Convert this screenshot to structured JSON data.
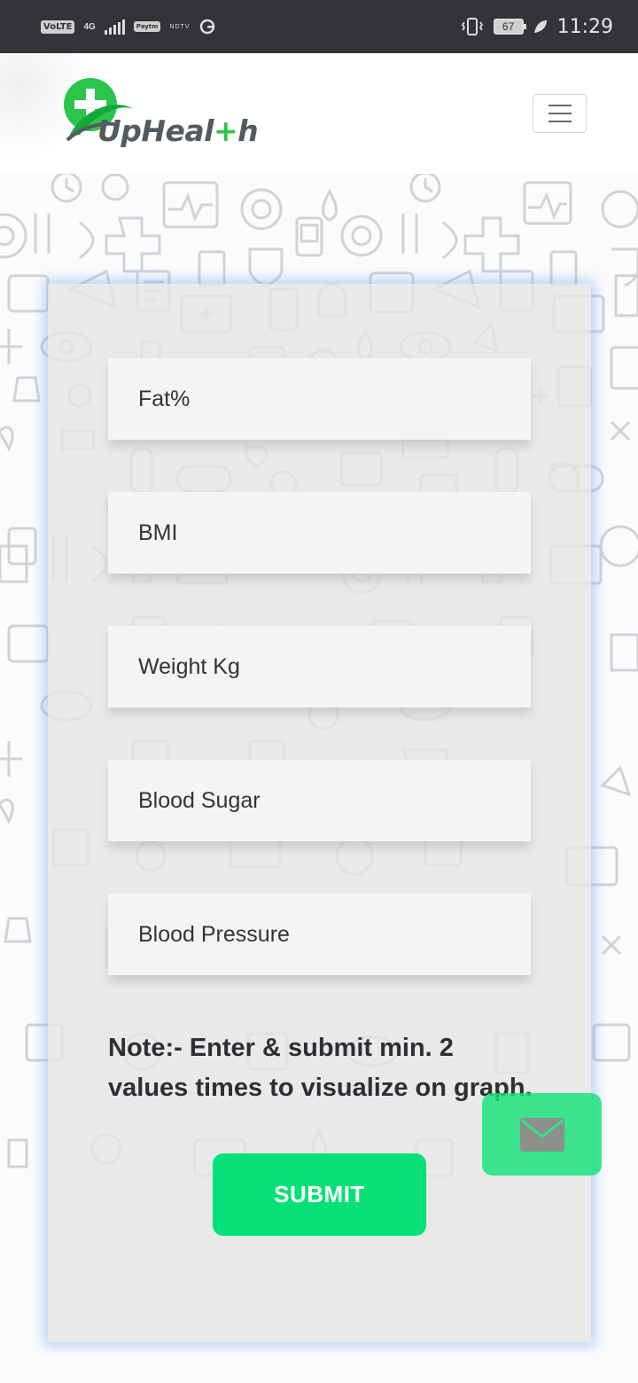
{
  "status_bar": {
    "volte": "VoLTE",
    "network": "4G",
    "app_chip": "Paytm",
    "news_chip": "NDTV",
    "battery": "67",
    "time": "11:29"
  },
  "header": {
    "logo_text_part1": "UpHeal",
    "logo_text_accent": "+",
    "logo_text_part2": "h",
    "brand_color": "#2bc54b"
  },
  "form": {
    "fields": [
      {
        "placeholder": "Fat%"
      },
      {
        "placeholder": "BMI"
      },
      {
        "placeholder": "Weight Kg"
      },
      {
        "placeholder": "Blood Sugar"
      },
      {
        "placeholder": "Blood Pressure"
      }
    ],
    "note": "Note:- Enter & submit min. 2 values times to visualize on graph.",
    "submit_label": "SUBMIT",
    "accent_color": "#05e177"
  },
  "icons": {
    "mail": "mail-icon",
    "menu": "hamburger-icon",
    "logo": "medical-cross-icon"
  }
}
